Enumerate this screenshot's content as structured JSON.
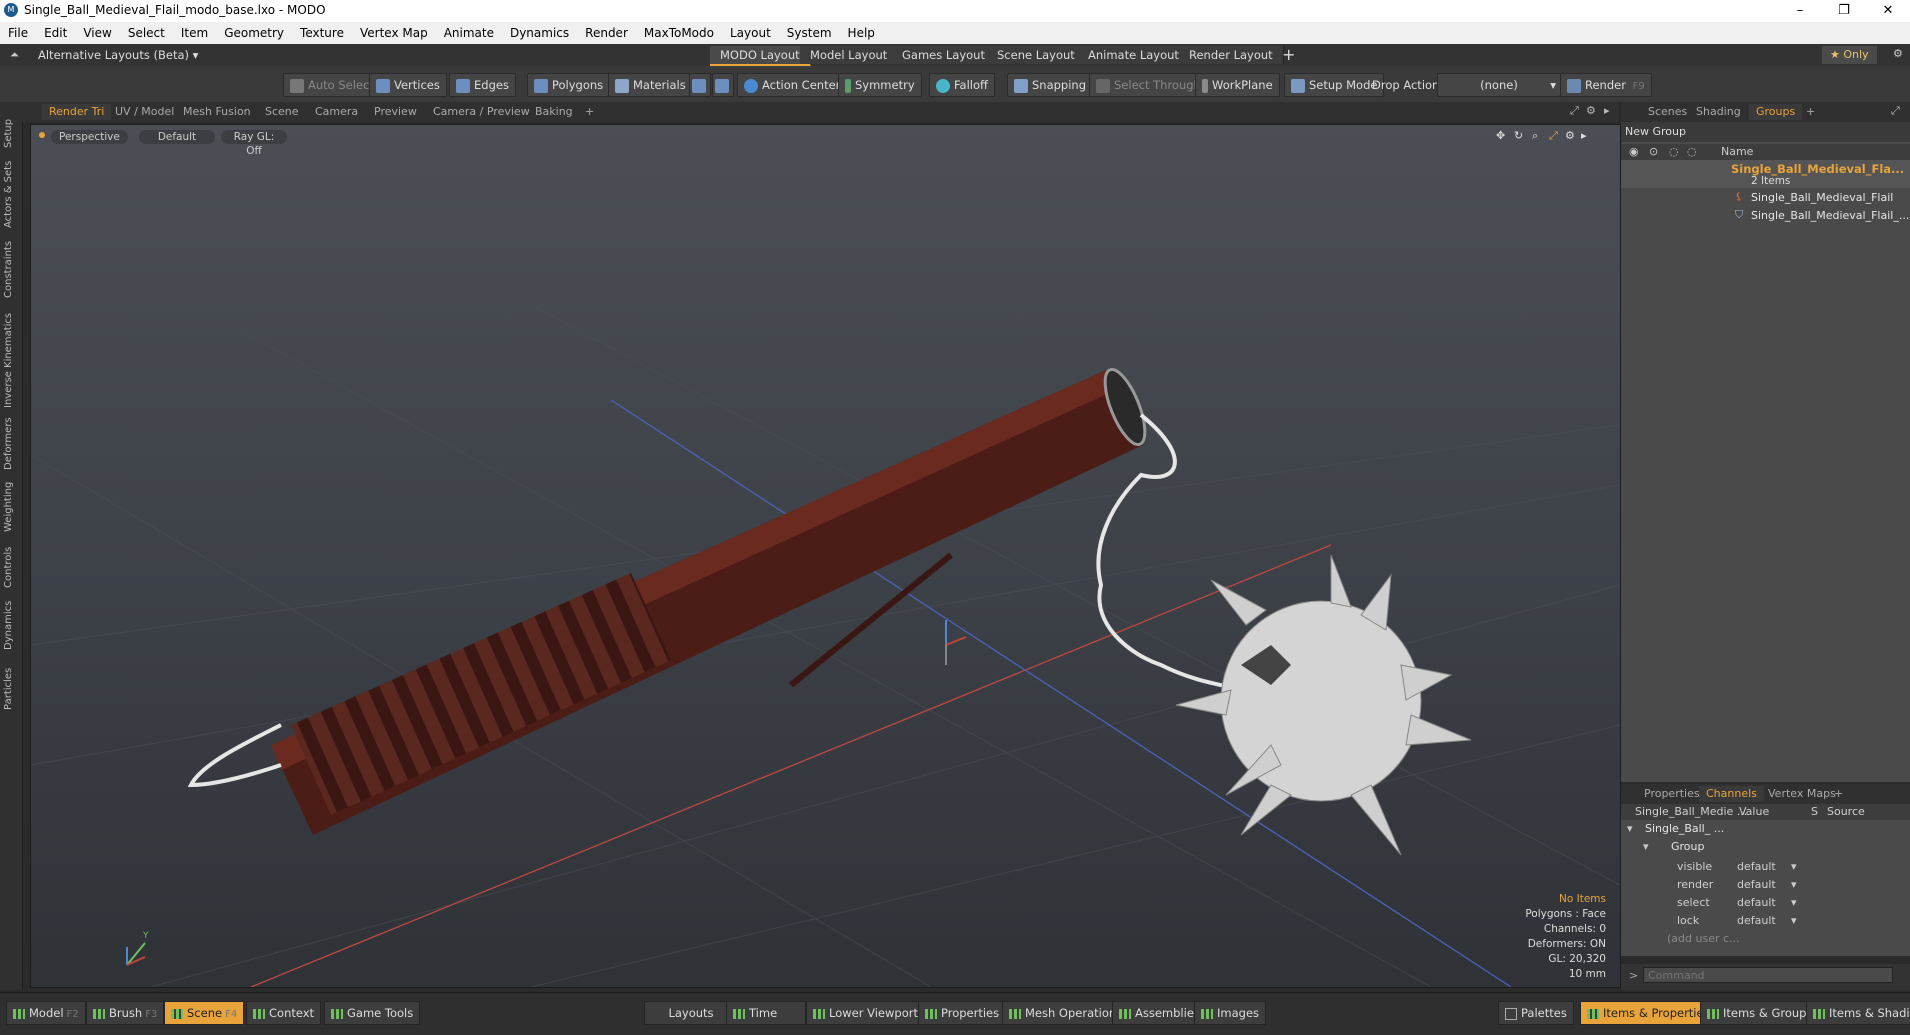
{
  "window": {
    "title": "Single_Ball_Medieval_Flail_modo_base.lxo - MODO",
    "minimize": "–",
    "maximize": "❐",
    "close": "✕"
  },
  "menu": [
    "File",
    "Edit",
    "View",
    "Select",
    "Item",
    "Geometry",
    "Texture",
    "Vertex Map",
    "Animate",
    "Dynamics",
    "Render",
    "MaxToModo",
    "Layout",
    "System",
    "Help"
  ],
  "layouts": {
    "selector": "Alternative Layouts (Beta) ▾",
    "tabs": [
      "MODO Layout",
      "Model Layout",
      "Games Layout",
      "Scene Layout",
      "Animate Layout",
      "Render Layout"
    ],
    "add": "+",
    "only": "★  Only"
  },
  "toolbar": {
    "auto_select": "Auto Select",
    "vertices": "Vertices",
    "edges": "Edges",
    "polygons": "Polygons",
    "materials": "Materials",
    "action_center": "Action Center",
    "symmetry": "Symmetry",
    "falloff": "Falloff",
    "snapping": "Snapping",
    "select_through": "Select Through",
    "workplane": "WorkPlane",
    "setup_mode": "Setup Mode",
    "drop_action": "Drop Action",
    "drop_value": "(none)",
    "render": "Render",
    "render_key": "F9"
  },
  "left_tabs": [
    "Setup",
    "Actors & Sets",
    "Constraints",
    "Inverse Kinematics",
    "Deformers",
    "Weighting",
    "Controls",
    "Dynamics",
    "Particles"
  ],
  "viewport_tabs": [
    "Render Tri",
    "UV / Model",
    "Mesh Fusion",
    "Scene",
    "Camera",
    "Preview",
    "Camera / Preview",
    "Baking",
    "+"
  ],
  "viewport": {
    "view": "Perspective",
    "shading": "Default",
    "raygl": "Ray GL: Off",
    "info": [
      "No Items",
      "Polygons : Face",
      "Channels: 0",
      "Deformers: ON",
      "GL: 20,320",
      "10 mm"
    ],
    "axis_y": "Y"
  },
  "right_tabs": [
    "Scenes",
    "Shading",
    "Groups",
    "+"
  ],
  "groups": {
    "new_group": "New Group",
    "name_header": "Name",
    "root": "Single_Ball_Medieval_Fla...",
    "count": "2 Items",
    "children": [
      "Single_Ball_Medieval_Flail",
      "Single_Ball_Medieval_Flail_..."
    ]
  },
  "channels_tabs": [
    "Properties",
    "Channels",
    "Vertex Maps",
    "+"
  ],
  "channels": {
    "headers": [
      "Single_Ball_Medie ...",
      "Value",
      "S",
      "Source"
    ],
    "item": "Single_Ball_ ...",
    "group": "Group",
    "rows": [
      {
        "name": "visible",
        "value": "default"
      },
      {
        "name": "render",
        "value": "default"
      },
      {
        "name": "select",
        "value": "default"
      },
      {
        "name": "lock",
        "value": "default"
      }
    ],
    "add": "(add user c..."
  },
  "command": {
    "prompt": ">",
    "placeholder": "Command"
  },
  "bottom": {
    "left": [
      {
        "label": "Model",
        "key": "F2"
      },
      {
        "label": "Brush",
        "key": "F3"
      },
      {
        "label": "Scene",
        "key": "F4"
      },
      {
        "label": "Context",
        "key": ""
      },
      {
        "label": "Game Tools",
        "key": ""
      }
    ],
    "middle": [
      "Layouts",
      "Time",
      "Lower Viewports",
      "Properties",
      "Mesh Operations",
      "Assemblies",
      "Images"
    ],
    "right": [
      "Palettes",
      "Items & Properties",
      "Items & Groups",
      "Items & Shading"
    ]
  }
}
